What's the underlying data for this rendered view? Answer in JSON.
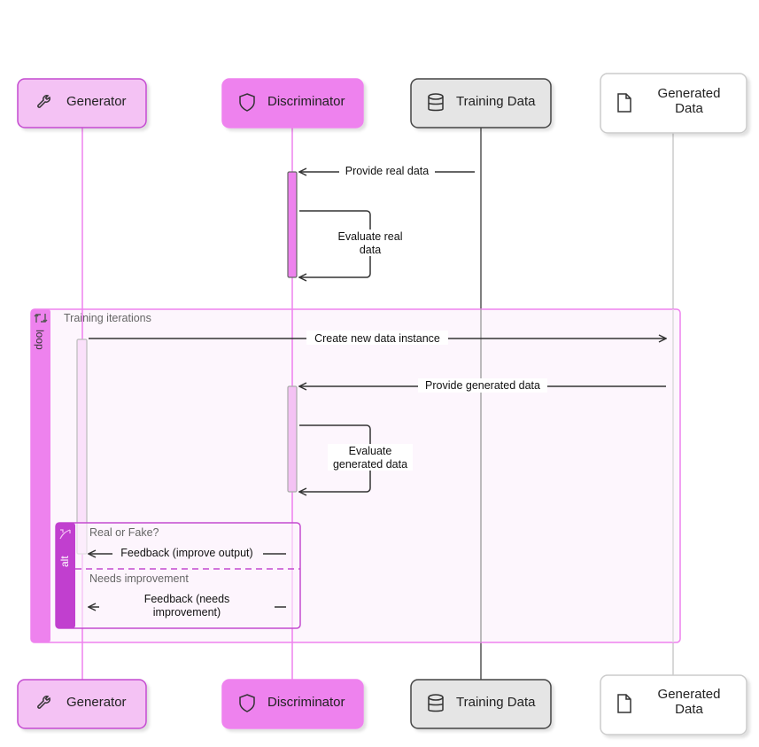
{
  "participants": [
    {
      "id": "generator",
      "label": "Generator",
      "icon": "wrench-icon",
      "fill": "#f4c2f4",
      "stroke": "#c44bd0",
      "lifeline": "#ee82ee"
    },
    {
      "id": "discriminator",
      "label": "Discriminator",
      "icon": "shield-icon",
      "fill": "#ee82ee",
      "stroke": "#ee82ee",
      "lifeline": "#ee82ee"
    },
    {
      "id": "training-data",
      "label": "Training Data",
      "icon": "database-icon",
      "fill": "#e5e5e5",
      "stroke": "#444444",
      "lifeline": "#555555"
    },
    {
      "id": "generated-data",
      "label_line1": "Generated",
      "label_line2": "Data",
      "icon": "file-icon",
      "fill": "#ffffff",
      "stroke": "#cccccc",
      "lifeline": "#cccccc"
    }
  ],
  "messages": {
    "provide_real": "Provide real data",
    "evaluate_real_1": "Evaluate real",
    "evaluate_real_2": "data",
    "create_new": "Create new data instance",
    "provide_generated": "Provide generated data",
    "evaluate_gen_1": "Evaluate",
    "evaluate_gen_2": "generated data",
    "feedback_improve": "Feedback (improve output)",
    "feedback_needs_1": "Feedback (needs",
    "feedback_needs_2": "improvement)"
  },
  "frames": {
    "loop": {
      "keyword": "loop",
      "label": "Training iterations",
      "color": "#ee82ee"
    },
    "alt": {
      "keyword": "alt",
      "condition1": "Real or Fake?",
      "condition2": "Needs improvement",
      "color": "#c13fcf"
    }
  }
}
